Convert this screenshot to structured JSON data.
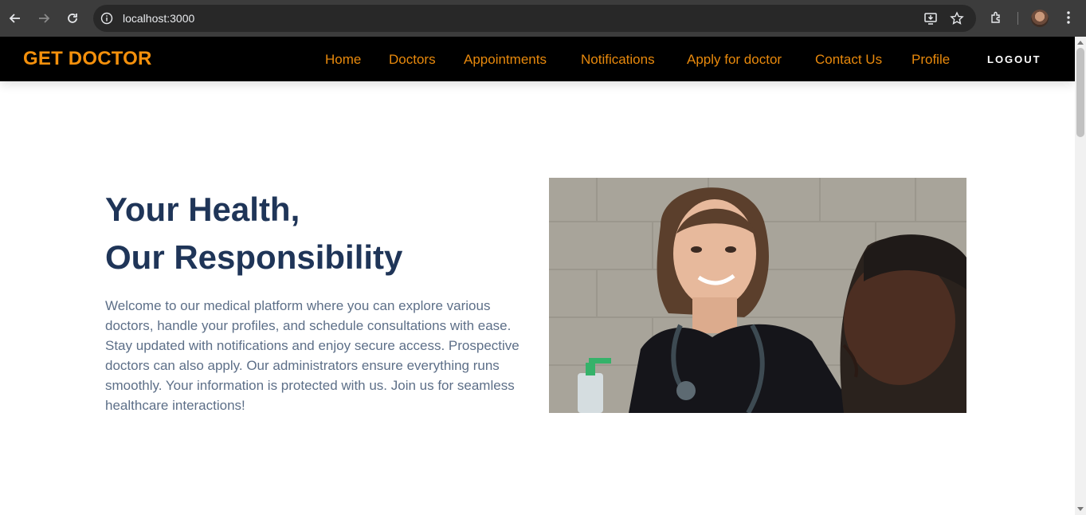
{
  "browser": {
    "url": "localhost:3000",
    "icons": [
      "back-icon",
      "forward-icon",
      "reload-icon",
      "site-info-icon",
      "install-app-icon",
      "bookmark-star-icon",
      "extensions-icon",
      "profile-avatar",
      "menu-kebab-icon"
    ]
  },
  "navbar": {
    "brand": "GET DOCTOR",
    "links": [
      "Home",
      "Doctors",
      "Appointments",
      "Notifications",
      "Apply for doctor",
      "Contact Us",
      "Profile"
    ],
    "logout": "LOGOUT",
    "colors": {
      "background": "#000000",
      "accent": "#f4900c"
    }
  },
  "hero": {
    "title_line1": "Your Health,",
    "title_line2": "Our Responsibility",
    "description": "Welcome to our medical platform where you can explore various doctors, handle your profiles, and schedule consultations with ease. Stay updated with notifications and enjoy secure access. Prospective doctors can also apply. Our administrators ensure everything runs smoothly. Your information is protected with us. Join us for seamless healthcare interactions!",
    "colors": {
      "title": "#1f3558",
      "text": "#5d6f88"
    }
  }
}
